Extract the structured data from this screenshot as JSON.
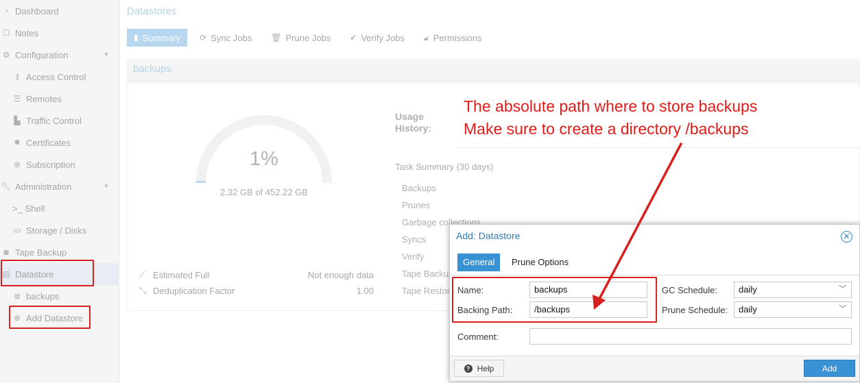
{
  "sidebar": {
    "items": [
      {
        "label": "Dashboard",
        "icon": "dashboard-icon"
      },
      {
        "label": "Notes",
        "icon": "notes-icon"
      },
      {
        "label": "Configuration",
        "icon": "gears-icon"
      },
      {
        "label": "Access Control",
        "icon": "key-icon"
      },
      {
        "label": "Remotes",
        "icon": "server-icon"
      },
      {
        "label": "Traffic Control",
        "icon": "bar-chart-icon"
      },
      {
        "label": "Certificates",
        "icon": "certificate-icon"
      },
      {
        "label": "Subscription",
        "icon": "support-icon"
      },
      {
        "label": "Administration",
        "icon": "wrench-icon"
      },
      {
        "label": ">_ Shell",
        "icon": "terminal-icon"
      },
      {
        "label": "Storage / Disks",
        "icon": "hdd-icon"
      },
      {
        "label": "Tape Backup",
        "icon": "tape-icon"
      },
      {
        "label": "Datastore",
        "icon": "archive-icon"
      },
      {
        "label": "backups",
        "icon": "database-icon"
      },
      {
        "label": "Add Datastore",
        "icon": "plus-circle-icon"
      }
    ]
  },
  "main": {
    "title": "Datastores",
    "tabs": [
      {
        "label": "Summary",
        "icon": "book-icon"
      },
      {
        "label": "Sync Jobs",
        "icon": "refresh-icon"
      },
      {
        "label": "Prune Jobs",
        "icon": "trash-icon"
      },
      {
        "label": "Verify Jobs",
        "icon": "check-circle-icon"
      },
      {
        "label": "Permissions",
        "icon": "unlock-icon"
      }
    ],
    "panel_title": "backups",
    "usage": {
      "percent_label": "1%",
      "percent_value": 0.01,
      "detail": "2.32 GB of 452.22 GB"
    },
    "stats": [
      {
        "label": "Estimated Full",
        "value": "Not enough data",
        "icon": "line-chart-icon"
      },
      {
        "label": "Deduplication Factor",
        "value": "1.00",
        "icon": "compress-icon"
      }
    ],
    "usage_history_label": "Usage History:",
    "task_summary_title": "Task Summary (30 days)",
    "task_items": [
      "Backups",
      "Prunes",
      "Garbage collections",
      "Syncs",
      "Verify",
      "Tape Backup",
      "Tape Restore"
    ]
  },
  "annotation": {
    "line1": "The absolute path where to store backups",
    "line2": "Make sure to create a directory /backups",
    "color": "#e01b18"
  },
  "dialog": {
    "title": "Add: Datastore",
    "tabs": [
      "General",
      "Prune Options"
    ],
    "fields": {
      "name_label": "Name:",
      "name_value": "backups",
      "backing_path_label": "Backing Path:",
      "backing_path_value": "/backups",
      "gc_schedule_label": "GC Schedule:",
      "gc_schedule_value": "daily",
      "prune_schedule_label": "Prune Schedule:",
      "prune_schedule_value": "daily",
      "comment_label": "Comment:",
      "comment_value": ""
    },
    "help_label": "Help",
    "add_label": "Add",
    "accent": "#3892d4"
  }
}
